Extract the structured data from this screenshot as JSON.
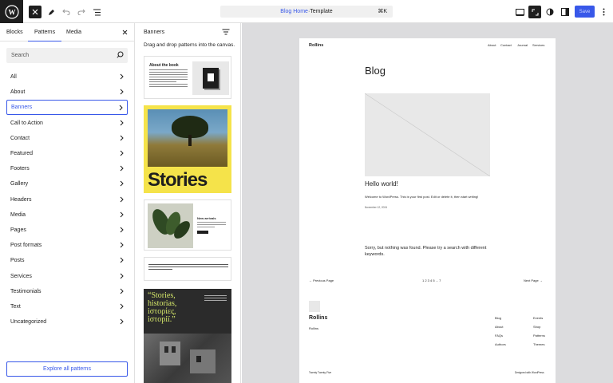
{
  "topbar": {
    "doc_title": "Blog Home",
    "doc_separator": " · ",
    "doc_type": "Template",
    "shortcut": "⌘K",
    "save_label": "Save",
    "icons": [
      "wordpress-icon",
      "close-icon",
      "pencil-icon",
      "undo-icon",
      "redo-icon",
      "list-view-icon",
      "view-icon",
      "fullscreen-icon",
      "styles-icon",
      "settings-icon",
      "more-icon"
    ]
  },
  "left_panel": {
    "tabs": [
      "Blocks",
      "Patterns",
      "Media"
    ],
    "active_tab": "Patterns",
    "search_placeholder": "Search",
    "categories": [
      "All",
      "About",
      "Banners",
      "Call to Action",
      "Contact",
      "Featured",
      "Footers",
      "Gallery",
      "Headers",
      "Media",
      "Pages",
      "Post formats",
      "Posts",
      "Services",
      "Testimonials",
      "Text",
      "Uncategorized"
    ],
    "selected_category": "Banners",
    "explore_label": "Explore all patterns"
  },
  "patterns_panel": {
    "title": "Banners",
    "hint": "Drag and drop patterns into the canvas.",
    "thumb1_heading": "About the book",
    "thumb2_text": "Stories",
    "thumb3_heading": "New arrivals",
    "thumb5_text": "“Stories, historias, iστορίες, iστоpiї.”"
  },
  "canvas": {
    "site_title": "Rollins",
    "nav": [
      "About",
      "Contact",
      "Journal",
      "Services"
    ],
    "page_heading": "Blog",
    "post_title": "Hello world!",
    "post_excerpt": "Welcome to WordPress. This is your first post. Edit or delete it, then start writing!",
    "post_date": "November 12, 2024",
    "no_results": "Sorry, but nothing was found. Please try a search with different keywords.",
    "prev_page": "← Previous Page",
    "pagination": "1 2 3 4 5 ... 7",
    "next_page": "Next Page →",
    "footer_title": "Rollins",
    "footer_sub": "Rollins",
    "footer_col1": [
      "Blog",
      "About",
      "FAQs",
      "Authors"
    ],
    "footer_col2": [
      "Events",
      "Shop",
      "Patterns",
      "Themes"
    ],
    "footer_left": "Twenty Twenty-Five",
    "footer_right": "Designed with WordPress"
  }
}
